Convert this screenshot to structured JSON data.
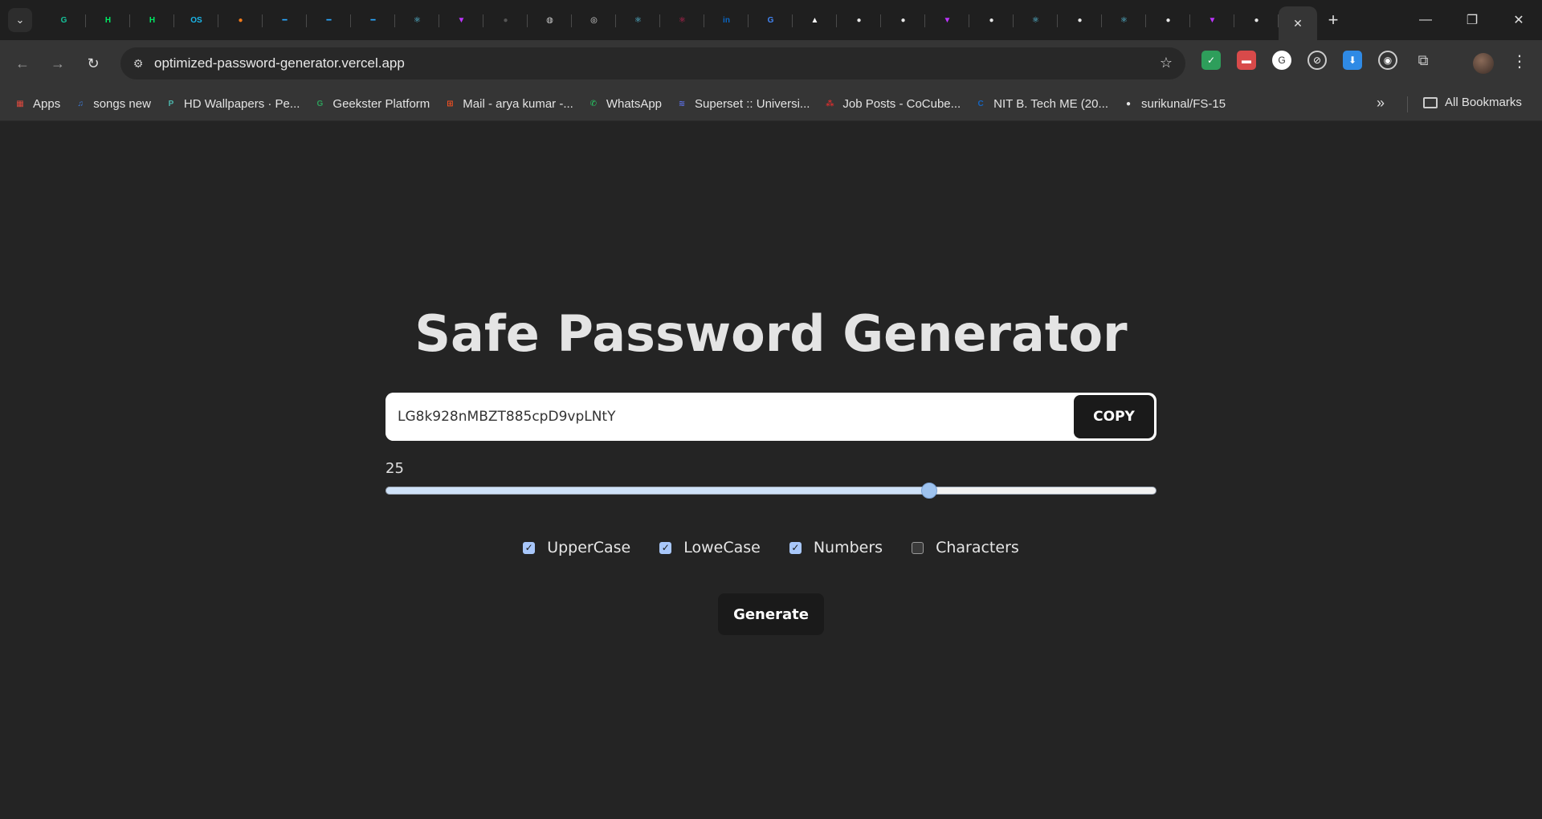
{
  "browser": {
    "tabs": [
      {
        "icon": "grammarly-icon",
        "glyph": "G",
        "color": "#15c39a"
      },
      {
        "icon": "hackerrank-icon",
        "glyph": "H",
        "color": "#00ea64"
      },
      {
        "icon": "hackerrank-icon",
        "glyph": "H",
        "color": "#00ea64"
      },
      {
        "icon": "os-icon",
        "glyph": "OS",
        "color": "#1ab7ea"
      },
      {
        "icon": "swiggy-icon",
        "glyph": "●",
        "color": "#f27a1a"
      },
      {
        "icon": "dash-icon",
        "glyph": "━",
        "color": "#2aa8ff"
      },
      {
        "icon": "dash-icon",
        "glyph": "━",
        "color": "#2aa8ff"
      },
      {
        "icon": "dash-icon",
        "glyph": "━",
        "color": "#2aa8ff"
      },
      {
        "icon": "react-icon",
        "glyph": "⚛",
        "color": "#61dafb"
      },
      {
        "icon": "vite-icon",
        "glyph": "▼",
        "color": "#bd34fe"
      },
      {
        "icon": "github-dim-icon",
        "glyph": "●",
        "color": "#555555"
      },
      {
        "icon": "globe-icon",
        "glyph": "◍",
        "color": "#cccccc"
      },
      {
        "icon": "circle-icon",
        "glyph": "◎",
        "color": "#dddddd"
      },
      {
        "icon": "react-icon",
        "glyph": "⚛",
        "color": "#61dafb"
      },
      {
        "icon": "react-red-icon",
        "glyph": "⚛",
        "color": "#e0245e"
      },
      {
        "icon": "linkedin-icon",
        "glyph": "in",
        "color": "#0a66c2"
      },
      {
        "icon": "google-icon",
        "glyph": "G",
        "color": "#4285f4"
      },
      {
        "icon": "vercel-icon",
        "glyph": "▲",
        "color": "#ffffff"
      },
      {
        "icon": "github-icon",
        "glyph": "●",
        "color": "#e6e6e6"
      },
      {
        "icon": "github-icon",
        "glyph": "●",
        "color": "#e6e6e6"
      },
      {
        "icon": "vite-icon",
        "glyph": "▼",
        "color": "#bd34fe"
      },
      {
        "icon": "github-icon",
        "glyph": "●",
        "color": "#e6e6e6"
      },
      {
        "icon": "react-icon",
        "glyph": "⚛",
        "color": "#61dafb"
      },
      {
        "icon": "github-icon",
        "glyph": "●",
        "color": "#e6e6e6"
      },
      {
        "icon": "react-icon",
        "glyph": "⚛",
        "color": "#61dafb"
      },
      {
        "icon": "github-icon",
        "glyph": "●",
        "color": "#e6e6e6"
      },
      {
        "icon": "vite-icon",
        "glyph": "▼",
        "color": "#bd34fe"
      },
      {
        "icon": "github-icon",
        "glyph": "●",
        "color": "#e6e6e6"
      }
    ],
    "url": "optimized-password-generator.vercel.app",
    "bookmarks": [
      {
        "label": "Apps",
        "glyph": "▦",
        "color": "#e04a3f"
      },
      {
        "label": "songs new",
        "glyph": "♫",
        "color": "#3d7de0"
      },
      {
        "label": "HD Wallpapers · Pe...",
        "glyph": "P",
        "color": "#4db6ac"
      },
      {
        "label": "Geekster Platform",
        "glyph": "G",
        "color": "#2e9e5b"
      },
      {
        "label": "Mail - arya kumar -...",
        "glyph": "⊞",
        "color": "#f25022"
      },
      {
        "label": "WhatsApp",
        "glyph": "✆",
        "color": "#25d366"
      },
      {
        "label": "Superset :: Universi...",
        "glyph": "≋",
        "color": "#5b6ee1"
      },
      {
        "label": "Job Posts - CoCube...",
        "glyph": "⁂",
        "color": "#d32f2f"
      },
      {
        "label": "NIT B. Tech ME (20...",
        "glyph": "C",
        "color": "#1565c0"
      },
      {
        "label": "surikunal/FS-15",
        "glyph": "●",
        "color": "#e6e6e6"
      }
    ],
    "all_bookmarks": "All Bookmarks"
  },
  "app": {
    "title": "Safe Password Generator",
    "password": "LG8k928nMBZT885cpD9vpLNtY",
    "copy_label": "COPY",
    "length": "25",
    "length_fraction": 0.705,
    "options": [
      {
        "label": "UpperCase",
        "checked": true
      },
      {
        "label": "LoweCase",
        "checked": true
      },
      {
        "label": "Numbers",
        "checked": true
      },
      {
        "label": "Characters",
        "checked": false
      }
    ],
    "generate_label": "Generate"
  }
}
